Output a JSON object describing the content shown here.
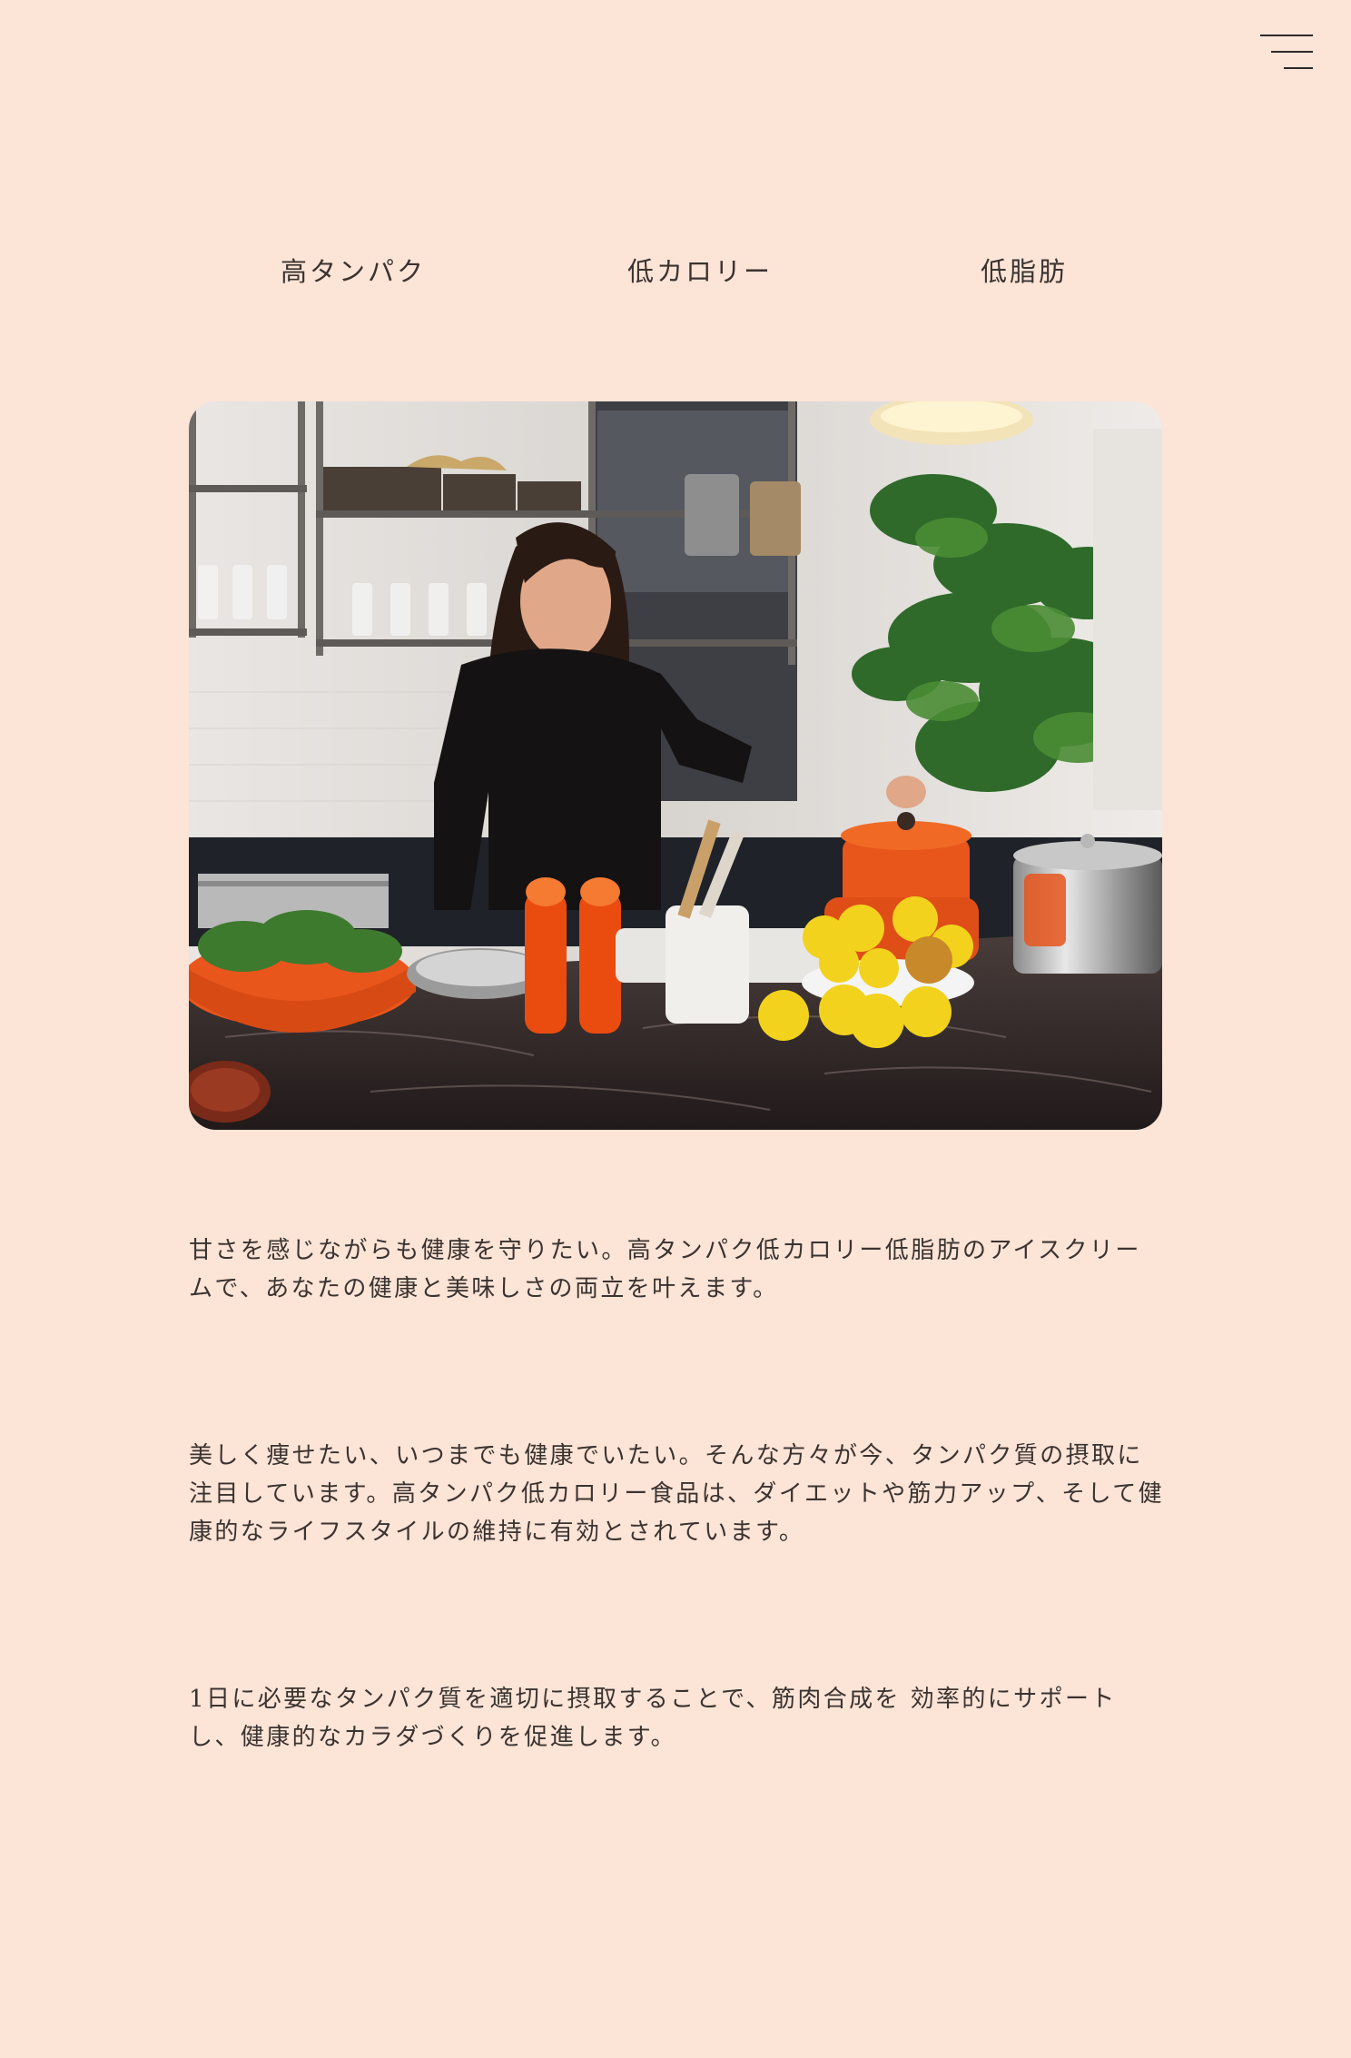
{
  "header": {
    "menu_icon": "hamburger-menu-icon"
  },
  "tags": [
    "高タンパク",
    "低カロリー",
    "低脂肪"
  ],
  "hero": {
    "image_icon": "kitchen-photo"
  },
  "paragraphs": [
    "甘さを感じながらも健康を守りたい。高タンパク低カロリー低脂肪のアイスクリームで、あなたの健康と美味しさの両立を叶えます。",
    "美しく痩せたい、いつまでも健康でいたい。そんな方々が今、タンパク質の摂取に注目しています。高タンパク低カロリー食品は、ダイエットや筋力アップ、そして健康的なライフスタイルの維持に有効とされています。",
    "1日に必要なタンパク質を適切に摂取することで、筋肉合成を 効率的にサポートし、健康的なカラダづくりを促進します。"
  ],
  "colors": {
    "background": "#fce4d6",
    "text": "#3a3330",
    "accent_orange": "#e8561c",
    "lemon": "#f2d21d"
  }
}
